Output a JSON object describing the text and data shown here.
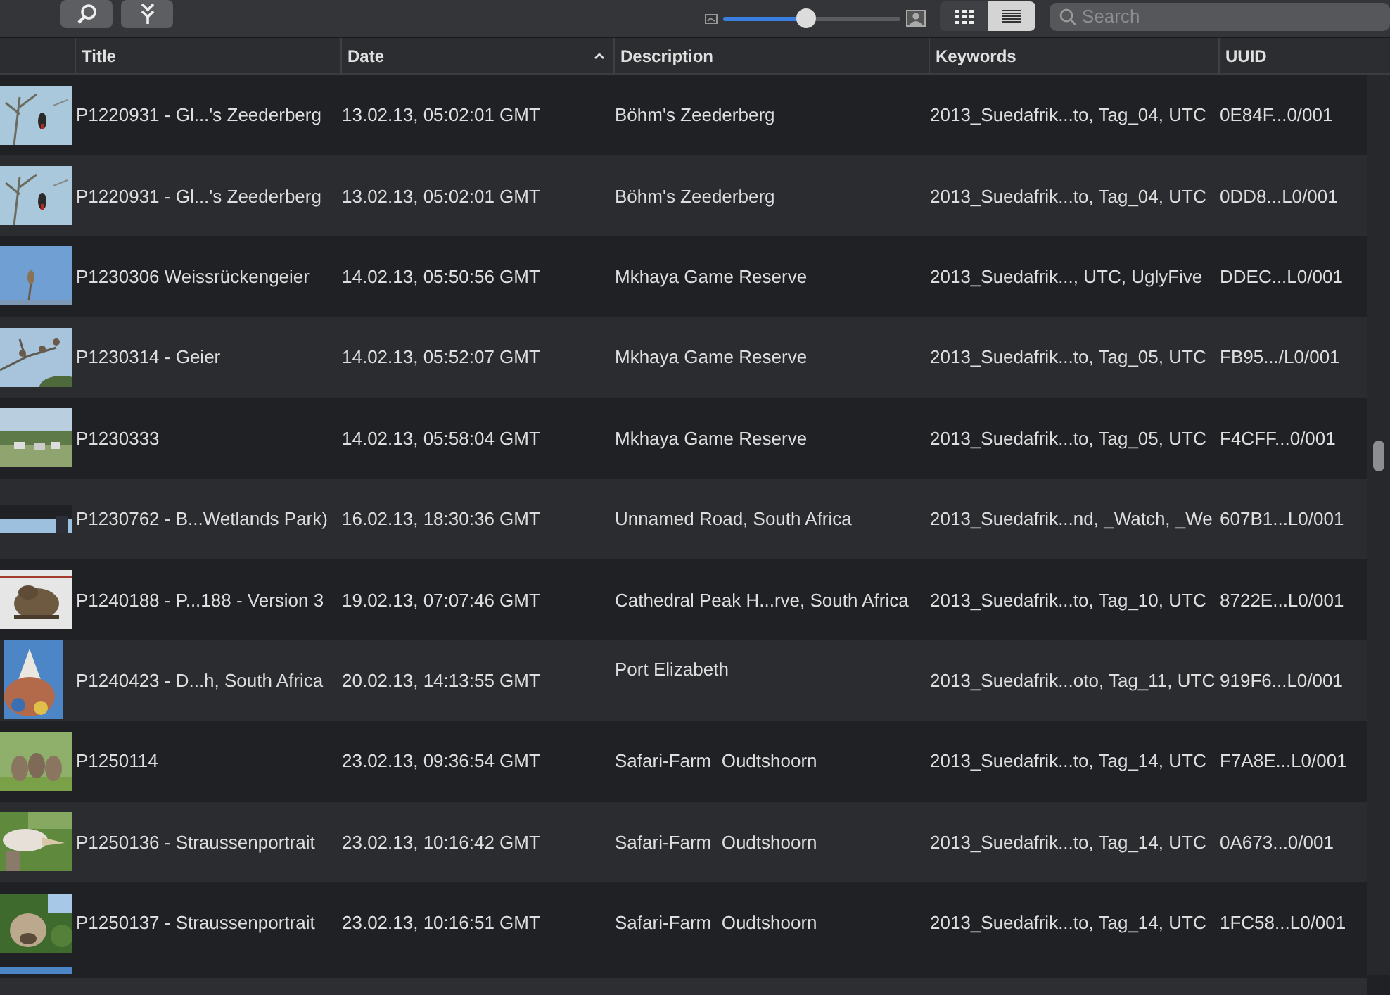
{
  "toolbar": {
    "buttons": [
      {
        "kind": "search"
      },
      {
        "kind": "import"
      }
    ],
    "zoom_slider": {
      "level": 0.47
    },
    "view_buttons": [
      {
        "kind": "grid",
        "selected": false
      },
      {
        "kind": "list",
        "selected": true
      }
    ],
    "search": {
      "placeholder": "Search"
    }
  },
  "table": {
    "columns": [
      {
        "label": "Title",
        "sorted": false
      },
      {
        "label": "Date",
        "sorted": true
      },
      {
        "label": "Description",
        "sorted": false
      },
      {
        "label": "Keywords",
        "sorted": false
      },
      {
        "label": "UUID",
        "sorted": false
      }
    ],
    "rows": [
      {
        "title": "P1220931 - Gl...'s Zeederberg",
        "date": "13.02.13, 05:02:01 GMT",
        "description": "Böhm's Zeederberg",
        "keywords": "2013_Suedafrik...to, Tag_04, UTC",
        "uuid": "0E84F...0/001"
      },
      {
        "title": "P1220931 - Gl...'s Zeederberg",
        "date": "13.02.13, 05:02:01 GMT",
        "description": "Böhm's Zeederberg",
        "keywords": "2013_Suedafrik...to, Tag_04, UTC",
        "uuid": "0DD8...L0/001"
      },
      {
        "title": "P1230306 Weissrückengeier",
        "date": "14.02.13, 05:50:56 GMT",
        "description": "Mkhaya Game Reserve",
        "keywords": "2013_Suedafrik..., UTC, UglyFive",
        "uuid": "DDEC...L0/001"
      },
      {
        "title": "P1230314 - Geier",
        "date": "14.02.13, 05:52:07 GMT",
        "description": "Mkhaya Game Reserve",
        "keywords": "2013_Suedafrik...to, Tag_05, UTC",
        "uuid": "FB95.../L0/001"
      },
      {
        "title": "P1230333",
        "date": "14.02.13, 05:58:04 GMT",
        "description": "Mkhaya Game Reserve",
        "keywords": "2013_Suedafrik...to, Tag_05, UTC",
        "uuid": "F4CFF...0/001"
      },
      {
        "title": "P1230762 - B...Wetlands Park)",
        "date": "16.02.13, 18:30:36 GMT",
        "description": "Unnamed Road, South Africa",
        "keywords": "2013_Suedafrik...nd, _Watch, _We",
        "uuid": "607B1...L0/001"
      },
      {
        "title": "P1240188 - P...188 - Version 3",
        "date": "19.02.13, 07:07:46 GMT",
        "description": "Cathedral Peak H...rve, South Africa",
        "keywords": "2013_Suedafrik...to, Tag_10, UTC",
        "uuid": "8722E...L0/001"
      },
      {
        "title": "P1240423 - D...h, South Africa",
        "date": "20.02.13, 14:13:55 GMT",
        "description": "Port Elizabeth",
        "keywords": "2013_Suedafrik...oto, Tag_11, UTC",
        "uuid": "919F6...L0/001"
      },
      {
        "title": "P1250114",
        "date": "23.02.13, 09:36:54 GMT",
        "description": "Safari-Farm  Oudtshoorn",
        "keywords": "2013_Suedafrik...to, Tag_14, UTC",
        "uuid": "F7A8E...L0/001"
      },
      {
        "title": "P1250136 - Straussenportrait",
        "date": "23.02.13, 10:16:42 GMT",
        "description": "Safari-Farm  Oudtshoorn",
        "keywords": "2013_Suedafrik...to, Tag_14, UTC",
        "uuid": "0A673...0/001"
      },
      {
        "title": "P1250137 - Straussenportrait",
        "date": "23.02.13, 10:16:51 GMT",
        "description": "Safari-Farm  Oudtshoorn",
        "keywords": "2013_Suedafrik...to, Tag_14, UTC",
        "uuid": "1FC58...L0/001"
      }
    ]
  }
}
